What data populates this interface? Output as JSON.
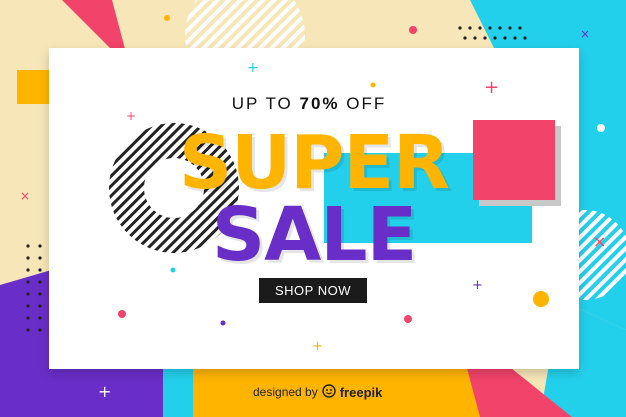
{
  "banner": {
    "headline_prefix": "UP TO",
    "headline_percent": "70%",
    "headline_suffix": "OFF",
    "title_line1": "SUPER",
    "title_line2": "SALE",
    "cta_label": "SHOP NOW"
  },
  "credit": {
    "prefix": "designed by",
    "brand": "freepik",
    "icon": "freepik-logo-icon"
  },
  "colors": {
    "cream": "#f7e6b8",
    "cyan": "#23d0ec",
    "purple": "#6a2ec8",
    "pink": "#f2436a",
    "yellow": "#ffb400",
    "black": "#1b1b1b"
  }
}
